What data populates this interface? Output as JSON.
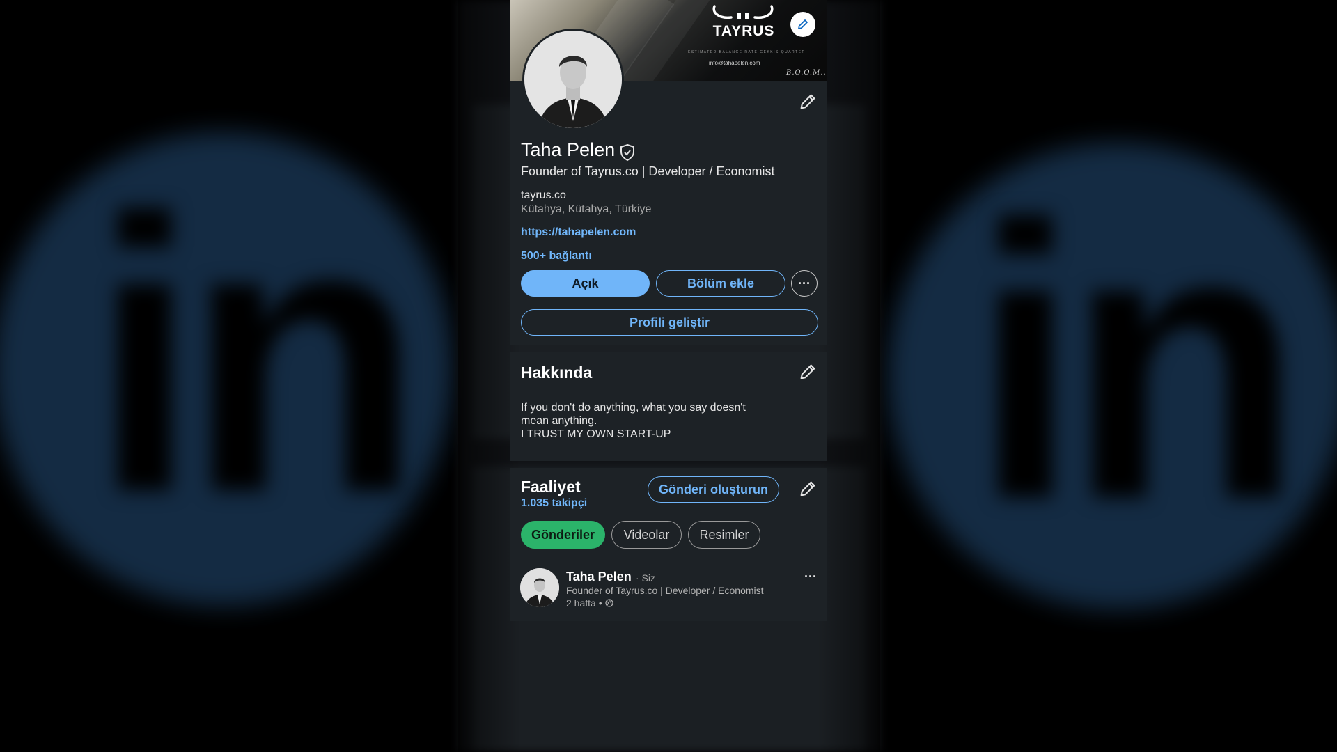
{
  "cover": {
    "brand_name": "TAYRUS",
    "brand_tagline": "ESTIMATED BALANCE RATE GEKKIS QUARTER",
    "brand_email": "info@tahapelen.com",
    "brand_sign": "B.O.O.M...."
  },
  "profile": {
    "name": "Taha Pelen",
    "headline": "Founder of Tayrus.co | Developer / Economist",
    "company": "tayrus.co",
    "location": "Kütahya, Kütahya, Türkiye",
    "website": "https://tahapelen.com",
    "connections": "500+ bağlantı",
    "open_button": "Açık",
    "add_section_button": "Bölüm ekle",
    "more_button": "···",
    "enhance_button": "Profili geliştir"
  },
  "about": {
    "title": "Hakkında",
    "lines": [
      "If you don't do anything, what you say doesn't",
      "mean anything.",
      "I TRUST MY OWN START-UP"
    ]
  },
  "activity": {
    "title": "Faaliyet",
    "followers": "1.035 takipçi",
    "create_post_button": "Gönderi oluşturun",
    "tabs": [
      "Gönderiler",
      "Videolar",
      "Resimler"
    ],
    "post": {
      "author": "Taha Pelen",
      "you_badge": "· Siz",
      "headline": "Founder of Tayrus.co | Developer / Economist",
      "time": "2 hafta •",
      "more": "···"
    }
  },
  "colors": {
    "card_bg": "#1d2226",
    "link_blue": "#71b7fb",
    "primary_button": "#70b5f9",
    "active_chip": "#2bb36a"
  }
}
